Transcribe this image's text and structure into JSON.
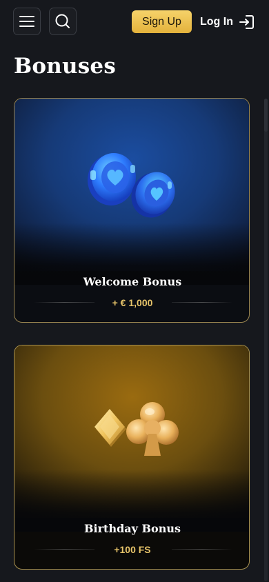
{
  "header": {
    "menu_icon": "hamburger-menu-icon",
    "search_icon": "search-icon",
    "signup_label": "Sign Up",
    "login_label": "Log In",
    "login_icon": "login-arrow-icon",
    "accent_color": "#e9b949"
  },
  "page": {
    "title": "Bonuses"
  },
  "bonuses": [
    {
      "title": "Welcome Bonus",
      "amount": "+ € 1,000",
      "art": "blue-poker-chips-icon",
      "theme_color": "#1b4da0"
    },
    {
      "title": "Birthday Bonus",
      "amount": "+100 FS",
      "art": "gold-diamond-club-icon",
      "theme_color": "#9a6b10"
    }
  ]
}
